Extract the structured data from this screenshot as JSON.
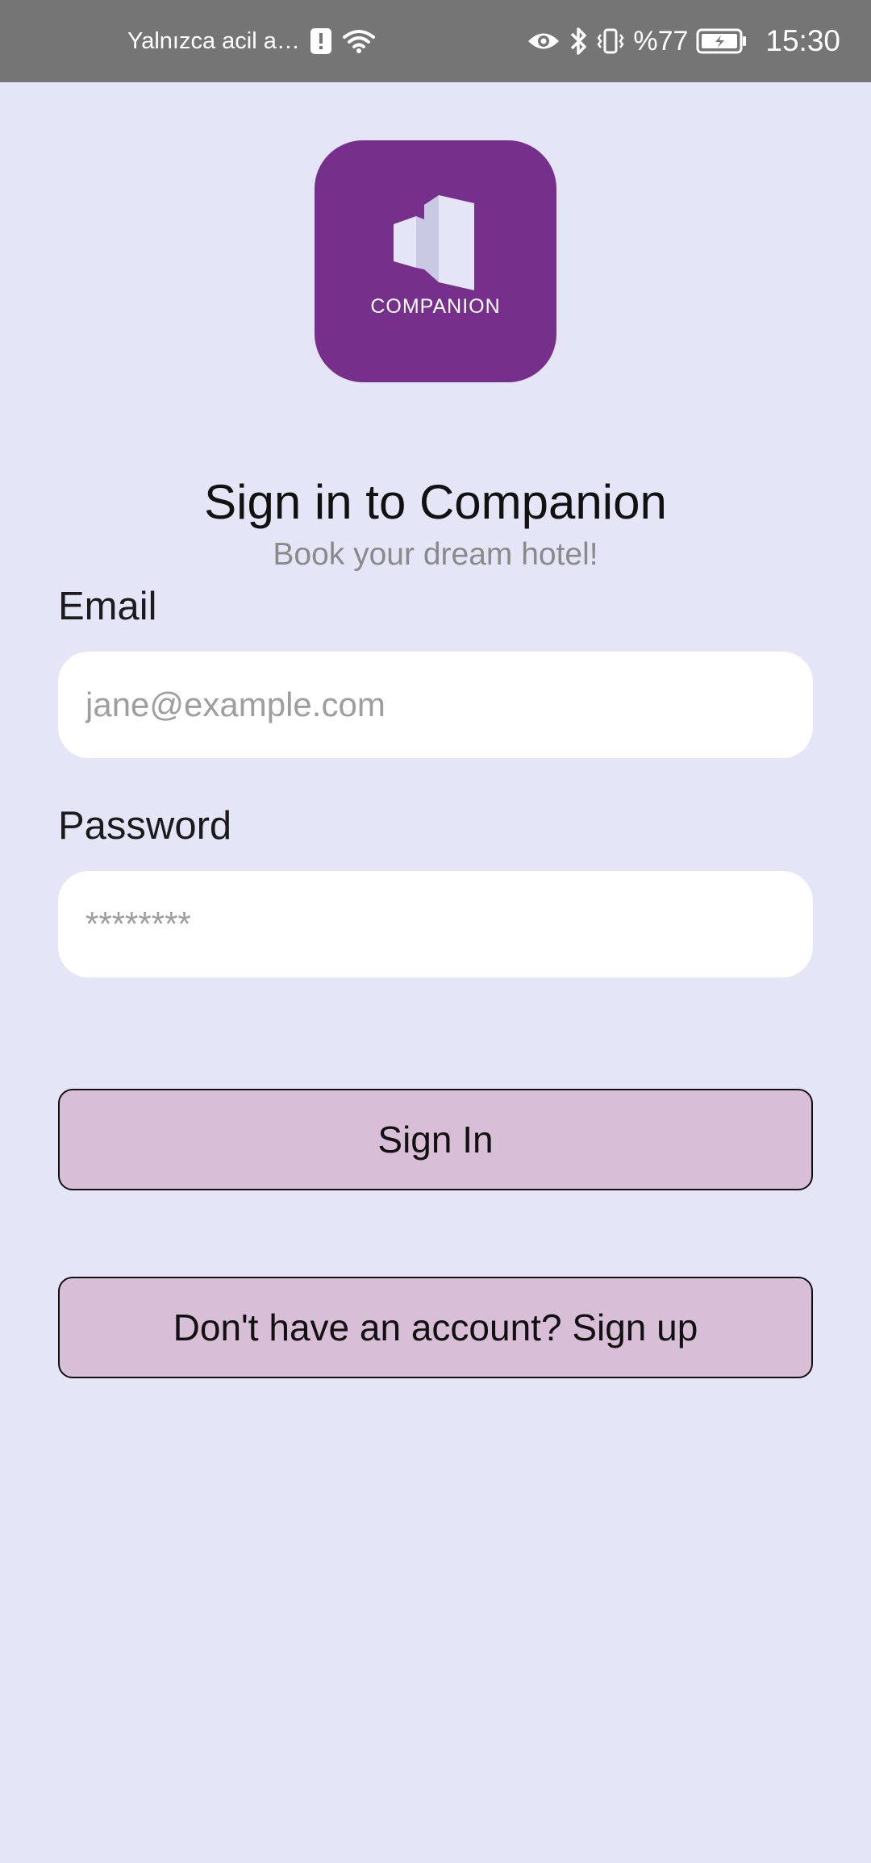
{
  "status_bar": {
    "carrier_text": "Yalnızca acil a…",
    "battery": "%77",
    "time": "15:30",
    "icons": [
      "alert-icon",
      "wifi-icon",
      "eye-icon",
      "bluetooth-icon",
      "vibrate-icon",
      "battery-icon"
    ]
  },
  "logo": {
    "text": "COMPANION",
    "bg_color": "#76308c"
  },
  "header": {
    "title": "Sign in to Companion",
    "subtitle": "Book your dream hotel!"
  },
  "form": {
    "email_label": "Email",
    "email_placeholder": "jane@example.com",
    "password_label": "Password",
    "password_placeholder": "********"
  },
  "buttons": {
    "sign_in": "Sign In",
    "sign_up": "Don't have an account? Sign up",
    "color": "#d8bed7"
  },
  "colors": {
    "background": "#e5e5f8",
    "status_bar": "#757575"
  }
}
